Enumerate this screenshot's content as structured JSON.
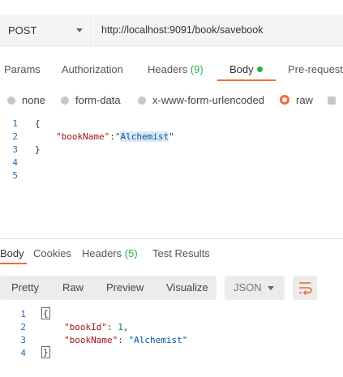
{
  "request": {
    "method": "POST",
    "url": "http://localhost:9091/book/savebook"
  },
  "request_tabs": {
    "params": "Params",
    "authorization": "Authorization",
    "headers": "Headers",
    "headers_count": "(9)",
    "body": "Body",
    "pre_request": "Pre-request"
  },
  "body_types": {
    "none": "none",
    "form_data": "form-data",
    "urlencoded": "x-www-form-urlencoded",
    "raw": "raw",
    "selected": "raw"
  },
  "editor": {
    "line_numbers": [
      "1",
      "2",
      "3",
      "4",
      "5"
    ],
    "open_brace": "{",
    "key": "\"bookName\"",
    "colon": ":",
    "value_quote_open": "\"",
    "value": "Alchemist",
    "value_quote_close": "\"",
    "close_brace": "}"
  },
  "response_tabs": {
    "body": "Body",
    "cookies": "Cookies",
    "headers": "Headers",
    "headers_count": "(5)",
    "test_results": "Test Results"
  },
  "response_toolbar": {
    "pretty": "Pretty",
    "raw": "Raw",
    "preview": "Preview",
    "visualize": "Visualize",
    "format": "JSON"
  },
  "response_body": {
    "line_numbers": [
      "1",
      "2",
      "3",
      "4"
    ],
    "open_brace": "{",
    "id_key": "\"bookId\"",
    "id_value": "1",
    "name_key": "\"bookName\"",
    "name_value": "\"Alchemist\"",
    "close_brace": "}"
  },
  "colors": {
    "accent": "#f26b3a",
    "success": "#26b047"
  },
  "icons": {
    "method_dropdown": "chevron-down-icon",
    "format_dropdown": "chevron-down-icon",
    "wrap": "wrap-lines-icon"
  }
}
